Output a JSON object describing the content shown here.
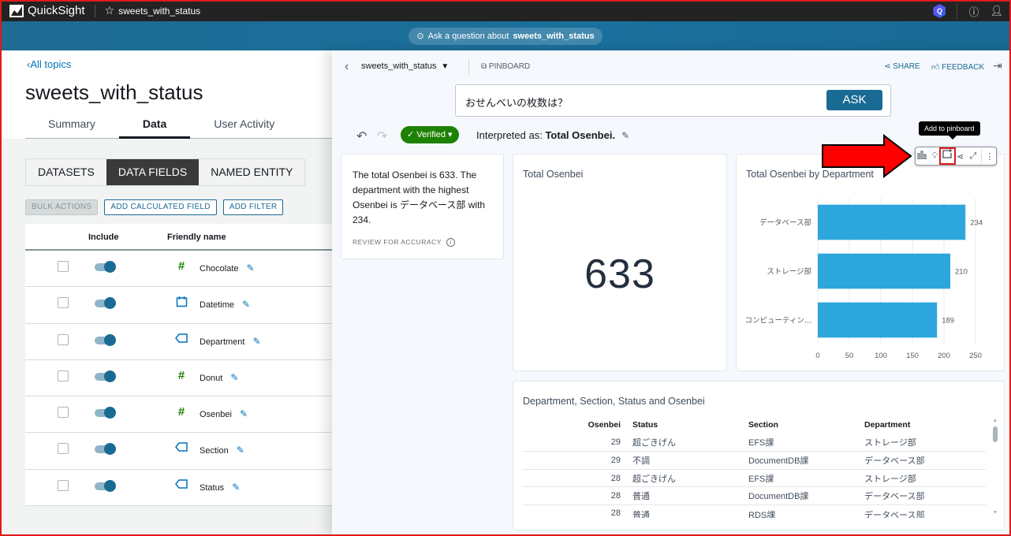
{
  "topbar": {
    "app_name": "QuickSight",
    "topic_name": "sweets_with_status",
    "icons": [
      "star-icon",
      "q-badge-icon",
      "help-icon",
      "user-icon"
    ]
  },
  "ask_bar": {
    "prefix": "Ask a question about",
    "topic": "sweets_with_status"
  },
  "left": {
    "back_link": "All topics",
    "title": "sweets_with_status",
    "tabs": [
      {
        "label": "Summary",
        "active": false
      },
      {
        "label": "Data",
        "active": true
      },
      {
        "label": "User Activity",
        "active": false
      }
    ],
    "segments": [
      {
        "label": "DATASETS",
        "active": false
      },
      {
        "label": "DATA FIELDS",
        "active": true
      },
      {
        "label": "NAMED ENTITY",
        "active": false
      }
    ],
    "actions": {
      "bulk": "BULK ACTIONS",
      "add_calc": "ADD CALCULATED FIELD",
      "add_filter": "ADD FILTER"
    },
    "table": {
      "headers": {
        "include": "Include",
        "friendly_name": "Friendly name"
      },
      "rows": [
        {
          "name": "Chocolate",
          "type": "number",
          "included": true,
          "checked": false
        },
        {
          "name": "Datetime",
          "type": "date",
          "included": true,
          "checked": false
        },
        {
          "name": "Department",
          "type": "dimension",
          "included": true,
          "checked": false
        },
        {
          "name": "Donut",
          "type": "number",
          "included": true,
          "checked": false
        },
        {
          "name": "Osenbei",
          "type": "number",
          "included": true,
          "checked": false
        },
        {
          "name": "Section",
          "type": "dimension",
          "included": true,
          "checked": false
        },
        {
          "name": "Status",
          "type": "dimension",
          "included": true,
          "checked": false
        }
      ]
    }
  },
  "right": {
    "topic_selector": "sweets_with_status",
    "pinboard": "PINBOARD",
    "share": "SHARE",
    "feedback": "FEEDBACK",
    "question": "おせんべいの枚数は？",
    "ask_button": "ASK",
    "verified": "Verified",
    "interpreted_prefix": "Interpreted as:",
    "interpreted_value": "Total Osenbei.",
    "summary": {
      "text": "The total Osenbei is 633. The department with the highest Osenbei is データベース部 with 234.",
      "review": "REVIEW FOR ACCURACY"
    },
    "kpi": {
      "title": "Total Osenbei",
      "value": "633"
    },
    "tooltip": "Add to pinboard",
    "toolbar_icons": [
      "bar-chart-icon",
      "lightbulb-icon",
      "add-to-pinboard-icon",
      "share-icon",
      "expand-icon",
      "more-icon"
    ],
    "data_table": {
      "title": "Department, Section, Status and Osenbei",
      "headers": [
        "Osenbei",
        "Status",
        "Section",
        "Department"
      ],
      "rows": [
        [
          "29",
          "超ごきげん",
          "EFS課",
          "ストレージ部"
        ],
        [
          "29",
          "不調",
          "DocumentDB課",
          "データベース部"
        ],
        [
          "28",
          "超ごきげん",
          "EFS課",
          "ストレージ部"
        ],
        [
          "28",
          "普通",
          "DocumentDB課",
          "データベース部"
        ],
        [
          "28",
          "普通",
          "RDS課",
          "データベース部"
        ]
      ]
    }
  },
  "chart_data": {
    "type": "bar",
    "orientation": "horizontal",
    "title": "Total Osenbei by Department",
    "categories": [
      "データベース部",
      "ストレージ部",
      "コンピューティン..."
    ],
    "values": [
      234,
      210,
      189
    ],
    "xlabel": "",
    "ylabel": "",
    "xlim": [
      0,
      250
    ],
    "xticks": [
      0,
      50,
      100,
      150,
      200,
      250
    ],
    "grid": true,
    "bar_color": "#2ca6dc",
    "data_labels": true
  }
}
